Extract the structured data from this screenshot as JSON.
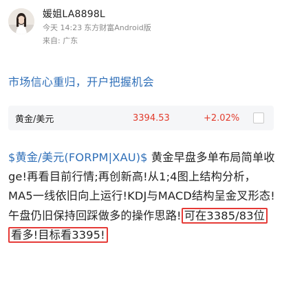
{
  "author": {
    "name": "媛姐LA8898L",
    "time": "今天 14:23",
    "source": "东方财富Android版",
    "location": "来自: 广东"
  },
  "headline": "市场信心重归，开户把握机会",
  "quote": {
    "name": "黄金/美元",
    "price": "3394.53",
    "change": "+2.02%",
    "accent_color": "#e23b2c"
  },
  "post": {
    "tag": "$黄金/美元(FORPM|XAU)$",
    "text_plain": "黄金早盘多单布局简单收ge!再看目前行情;再创新高!从1;4图上结构分析，MA5一线依旧向上运行!KDJ与MACD结构呈金叉形态!午盘仍旧保持回踩做多的操作思路!",
    "text_highlight": "可在3385/83位看多!目标看3395!",
    "highlight_color": "#e53935",
    "link_color": "#2f6fb8"
  },
  "icons": {
    "avatar": "avatar-image",
    "checkbox": "checkbox-icon"
  }
}
